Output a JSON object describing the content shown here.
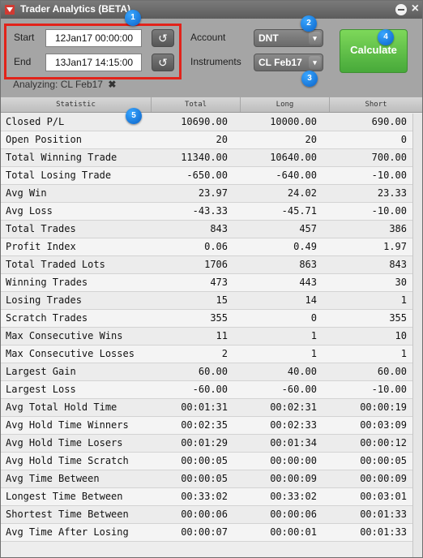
{
  "window": {
    "title": "Trader Analytics (BETA)"
  },
  "controls": {
    "start_label": "Start",
    "start_value": "12Jan17 00:00:00",
    "end_label": "End",
    "end_value": "13Jan17 14:15:00",
    "reset_glyph": "↺",
    "account_label": "Account",
    "account_value": "DNT",
    "instruments_label": "Instruments",
    "instruments_value": "CL Feb17",
    "dropdown_glyph": "▾",
    "calculate_label": "Calculate",
    "analyzing_label": "Analyzing:",
    "analyzing_value": "CL Feb17",
    "analyzing_remove_glyph": "✖"
  },
  "badges": [
    "1",
    "2",
    "3",
    "4",
    "5"
  ],
  "table": {
    "headers": [
      "Statistic",
      "Total",
      "Long",
      "Short"
    ],
    "rows": [
      [
        "Closed P/L",
        "10690.00",
        "10000.00",
        "690.00"
      ],
      [
        "Open Position",
        "20",
        "20",
        "0"
      ],
      [
        "Total Winning Trade",
        "11340.00",
        "10640.00",
        "700.00"
      ],
      [
        "Total Losing Trade",
        "-650.00",
        "-640.00",
        "-10.00"
      ],
      [
        "Avg Win",
        "23.97",
        "24.02",
        "23.33"
      ],
      [
        "Avg Loss",
        "-43.33",
        "-45.71",
        "-10.00"
      ],
      [
        "Total Trades",
        "843",
        "457",
        "386"
      ],
      [
        "Profit Index",
        "0.06",
        "0.49",
        "1.97"
      ],
      [
        "Total Traded Lots",
        "1706",
        "863",
        "843"
      ],
      [
        "Winning Trades",
        "473",
        "443",
        "30"
      ],
      [
        "Losing Trades",
        "15",
        "14",
        "1"
      ],
      [
        "Scratch Trades",
        "355",
        "0",
        "355"
      ],
      [
        "Max Consecutive Wins",
        "11",
        "1",
        "10"
      ],
      [
        "Max Consecutive Losses",
        "2",
        "1",
        "1"
      ],
      [
        "Largest Gain",
        "60.00",
        "40.00",
        "60.00"
      ],
      [
        "Largest Loss",
        "-60.00",
        "-60.00",
        "-10.00"
      ],
      [
        "Avg Total Hold Time",
        "00:01:31",
        "00:02:31",
        "00:00:19"
      ],
      [
        "Avg Hold Time Winners",
        "00:02:35",
        "00:02:33",
        "00:03:09"
      ],
      [
        "Avg Hold Time Losers",
        "00:01:29",
        "00:01:34",
        "00:00:12"
      ],
      [
        "Avg Hold Time Scratch",
        "00:00:05",
        "00:00:00",
        "00:00:05"
      ],
      [
        "Avg Time Between",
        "00:00:05",
        "00:00:09",
        "00:00:09"
      ],
      [
        "Longest Time Between",
        "00:33:02",
        "00:33:02",
        "00:03:01"
      ],
      [
        "Shortest Time Between",
        "00:00:06",
        "00:00:06",
        "00:01:33"
      ],
      [
        "Avg Time After Losing",
        "00:00:07",
        "00:00:01",
        "00:01:33"
      ]
    ]
  }
}
